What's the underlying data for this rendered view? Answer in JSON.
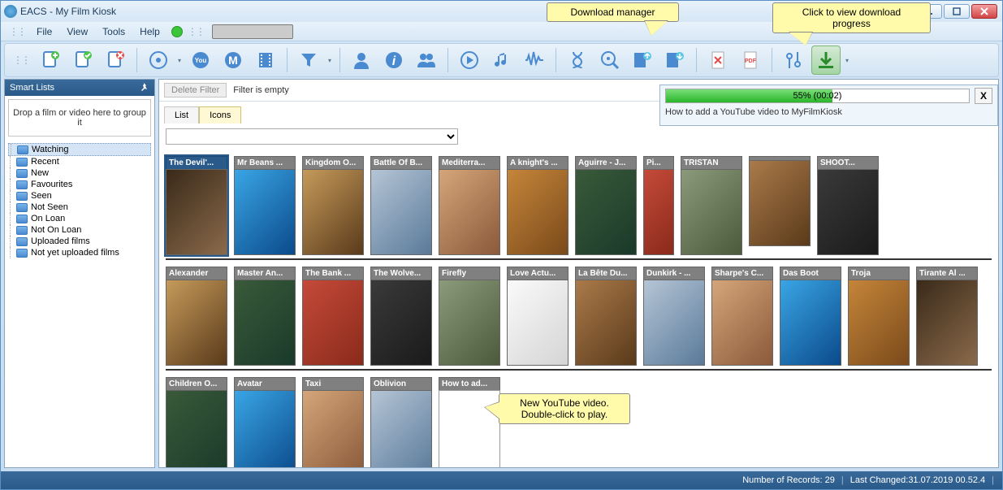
{
  "titlebar": {
    "title": "EACS - My Film Kiosk"
  },
  "menu": {
    "file": "File",
    "view": "View",
    "tools": "Tools",
    "help": "Help"
  },
  "callouts": {
    "dlmgr": "Download manager",
    "dlprogress": "Click to view download\nprogress",
    "newvid": "New YouTube video.\nDouble-click to play."
  },
  "sidebar": {
    "title": "Smart Lists",
    "dropzone": "Drop a film or video here to group it",
    "items": [
      {
        "label": "Watching",
        "selected": true
      },
      {
        "label": "Recent"
      },
      {
        "label": "New"
      },
      {
        "label": "Favourites"
      },
      {
        "label": "Seen"
      },
      {
        "label": "Not Seen"
      },
      {
        "label": "On Loan"
      },
      {
        "label": "Not On Loan"
      },
      {
        "label": "Uploaded films"
      },
      {
        "label": "Not yet uploaded films"
      }
    ]
  },
  "filterbar": {
    "delete": "Delete Filter",
    "status": "Filter is empty"
  },
  "viewtabs": {
    "list": "List",
    "icons": "Icons"
  },
  "download": {
    "percent": 55,
    "label": "55% (00:02)",
    "desc": "How to add a YouTube video to MyFilmKiosk",
    "close": "X"
  },
  "films": {
    "row1": [
      {
        "t": "The Devil'...",
        "sel": true,
        "p": 0
      },
      {
        "t": "Mr Beans ...",
        "sel": false,
        "p": 1
      },
      {
        "t": "Kingdom O...",
        "sel": false,
        "p": 2
      },
      {
        "t": "Battle Of B...",
        "sel": false,
        "p": 3
      },
      {
        "t": "Mediterra...",
        "sel": false,
        "p": 4
      },
      {
        "t": "A knight's ...",
        "sel": false,
        "p": 5
      },
      {
        "t": "Aguirre - J...",
        "sel": false,
        "p": 6
      },
      {
        "t": "Pi...",
        "sel": false,
        "p": 7
      },
      {
        "t": "TRISTAN",
        "sel": false,
        "p": 8
      },
      {
        "t": "",
        "sel": false,
        "p": 9
      },
      {
        "t": "SHOOT...",
        "sel": false,
        "p": 10
      }
    ],
    "row2": [
      {
        "t": "Alexander",
        "p": 2
      },
      {
        "t": "Master An...",
        "p": 6
      },
      {
        "t": "The Bank ...",
        "p": 7
      },
      {
        "t": "The Wolve...",
        "p": 10
      },
      {
        "t": "Firefly",
        "p": 8
      },
      {
        "t": "Love Actu...",
        "p": 11
      },
      {
        "t": "La Bête Du...",
        "p": 9
      },
      {
        "t": "Dunkirk - ...",
        "p": 3
      },
      {
        "t": "Sharpe's C...",
        "p": 4
      },
      {
        "t": "Das Boot",
        "p": 1
      },
      {
        "t": "Troja",
        "p": 5
      },
      {
        "t": "Tirante Al ...",
        "p": 0
      }
    ],
    "row3": [
      {
        "t": "Children O...",
        "p": 6
      },
      {
        "t": "Avatar",
        "p": 1
      },
      {
        "t": "Taxi",
        "p": 4
      },
      {
        "t": "Oblivion",
        "p": 3
      },
      {
        "t": "How to ad...",
        "p": -1
      }
    ]
  },
  "statusbar": {
    "records": "Number of Records: 29",
    "changed": "Last Changed:31.07.2019 00.52.4"
  }
}
